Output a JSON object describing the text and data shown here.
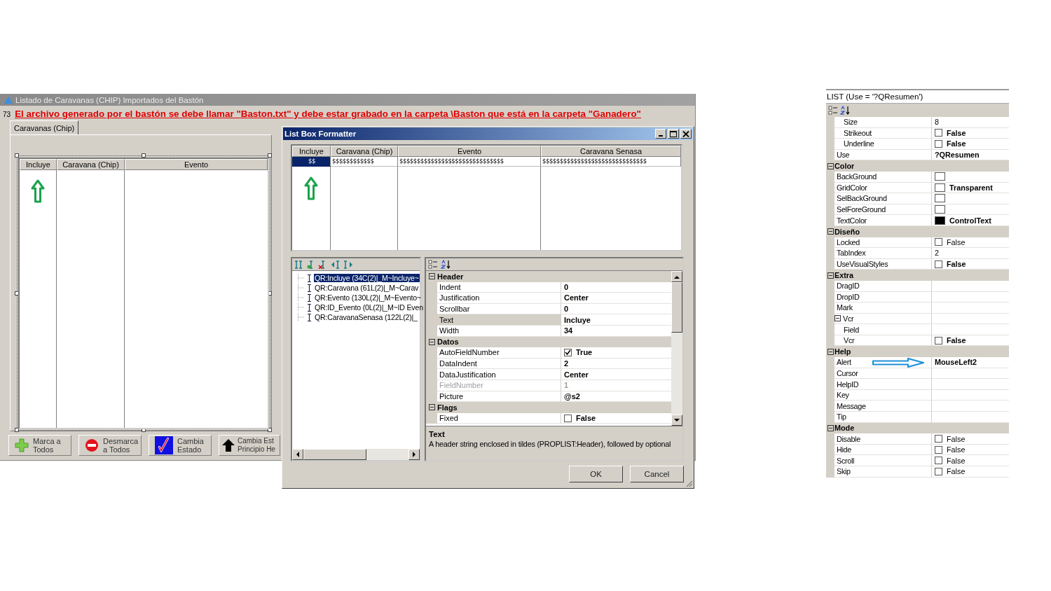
{
  "main_window": {
    "title": "Listado de Caravanas (CHIP) Importados del Bastón",
    "line_number": "73",
    "warning": "El archivo generado por el bastón se debe llamar \"Baston.txt\" y debe estar grabado en la carpeta \\Baston que está en la carpeta \"Ganadero\"",
    "tabs": [
      {
        "label": "Caravanas (Chip)",
        "selected": true
      }
    ],
    "list": {
      "columns": [
        "Incluye",
        "Caravana (Chip)",
        "Evento"
      ]
    },
    "buttons": [
      {
        "label": "Marca a\nTodos",
        "kind": "plus"
      },
      {
        "label": "Desmarca\na Todos",
        "kind": "no-entry"
      },
      {
        "label": "Cambia\nEstado",
        "kind": "check"
      },
      {
        "label": "Cambia Est\nPrincipio He",
        "kind": "up-arrow"
      }
    ]
  },
  "formatter": {
    "title": "List Box Formatter",
    "preview": {
      "columns": [
        "Incluye",
        "Caravana (Chip)",
        "Evento",
        "Caravana Senasa"
      ],
      "cells": [
        {
          "text": "$$",
          "selected": true
        },
        {
          "text": "$$$$$$$$$$$$",
          "selected": false
        },
        {
          "text": "$$$$$$$$$$$$$$$$$$$$$$$$$$$$$$",
          "selected": false
        },
        {
          "text": "$$$$$$$$$$$$$$$$$$$$$$$$$$$$$$",
          "selected": false
        }
      ]
    },
    "tree": [
      {
        "label": "QR:Incluye (34C(2)|_M~Incluye~",
        "selected": true
      },
      {
        "label": "QR:Caravana (61L(2)|_M~Carav",
        "selected": false
      },
      {
        "label": "QR:Evento (130L(2)|_M~Evento~",
        "selected": false
      },
      {
        "label": "QR:ID_Evento (0L(2)|_M~ID Even",
        "selected": false
      },
      {
        "label": "QR:CaravanaSenasa (122L(2)|_",
        "selected": false
      }
    ],
    "properties": {
      "sections": [
        {
          "name": "Header",
          "expanded": true,
          "rows": [
            {
              "name": "Indent",
              "kind": "text",
              "value": "0",
              "selected": false,
              "disabled": false
            },
            {
              "name": "Justification",
              "kind": "text",
              "value": "Center",
              "selected": false,
              "disabled": false
            },
            {
              "name": "Scrollbar",
              "kind": "text",
              "value": "0",
              "selected": false,
              "disabled": false
            },
            {
              "name": "Text",
              "kind": "text",
              "value": "Incluye",
              "selected": true,
              "disabled": false
            },
            {
              "name": "Width",
              "kind": "text",
              "value": "34",
              "selected": false,
              "disabled": false
            }
          ]
        },
        {
          "name": "Datos",
          "expanded": true,
          "rows": [
            {
              "name": "AutoFieldNumber",
              "kind": "checkbox",
              "checked": true,
              "value": "True",
              "selected": false,
              "disabled": false
            },
            {
              "name": "DataIndent",
              "kind": "text",
              "value": "2",
              "selected": false,
              "disabled": false
            },
            {
              "name": "DataJustification",
              "kind": "text",
              "value": "Center",
              "selected": false,
              "disabled": false
            },
            {
              "name": "FieldNumber",
              "kind": "text",
              "value": "1",
              "selected": false,
              "disabled": true
            },
            {
              "name": "Picture",
              "kind": "text",
              "value": "@s2",
              "selected": false,
              "disabled": false
            }
          ]
        },
        {
          "name": "Flags",
          "expanded": true,
          "rows": [
            {
              "name": "Fixed",
              "kind": "checkbox",
              "checked": false,
              "value": "False",
              "selected": false,
              "disabled": false
            }
          ]
        }
      ]
    },
    "description": {
      "title": "Text",
      "text": "A header string enclosed in tildes (PROPLIST:Header), followed by optional"
    },
    "buttons": [
      "OK",
      "Cancel"
    ]
  },
  "property_panel": {
    "title": "LIST (Use = '?QResumen')",
    "sections": [
      {
        "rows": [
          {
            "kind": "group",
            "children": [
              {
                "name": "Size",
                "kind": "text",
                "value": "8",
                "bold": false
              },
              {
                "name": "Strikeout",
                "kind": "checkbox",
                "checked": false,
                "value": "False",
                "bold": true
              },
              {
                "name": "Underline",
                "kind": "checkbox",
                "checked": false,
                "value": "False",
                "bold": true
              }
            ]
          },
          {
            "name": "Use",
            "kind": "text",
            "value": "?QResumen",
            "bold": true
          }
        ]
      },
      {
        "name": "Color",
        "expanded": true,
        "rows": [
          {
            "name": "BackGround",
            "kind": "swatch",
            "color": "#ffffff"
          },
          {
            "name": "GridColor",
            "kind": "swatch",
            "color": "#ffffff",
            "value": "Transparent",
            "bold": true
          },
          {
            "name": "SelBackGround",
            "kind": "swatch",
            "color": "#ffffff"
          },
          {
            "name": "SelForeGround",
            "kind": "swatch",
            "color": "#ffffff"
          },
          {
            "name": "TextColor",
            "kind": "swatch",
            "color": "#000000",
            "value": "ControlText",
            "bold": true
          }
        ]
      },
      {
        "name": "Diseño",
        "expanded": true,
        "rows": [
          {
            "name": "Locked",
            "kind": "checkbox",
            "checked": false,
            "value": "False",
            "bold": false
          },
          {
            "name": "TabIndex",
            "kind": "text",
            "value": "2",
            "bold": false
          },
          {
            "name": "UseVisualStyles",
            "kind": "checkbox",
            "checked": false,
            "value": "False",
            "bold": true
          }
        ]
      },
      {
        "name": "Extra",
        "expanded": true,
        "rows": [
          {
            "name": "DragID",
            "kind": "text"
          },
          {
            "name": "DropID",
            "kind": "text"
          },
          {
            "name": "Mark",
            "kind": "text"
          },
          {
            "name": "Vcr",
            "kind": "group",
            "expanded": true,
            "children": [
              {
                "name": "Field",
                "kind": "text"
              },
              {
                "name": "Vcr",
                "kind": "checkbox",
                "checked": false,
                "value": "False",
                "bold": true
              }
            ]
          }
        ]
      },
      {
        "name": "Help",
        "expanded": true,
        "rows": [
          {
            "name": "Alert",
            "kind": "text",
            "value": "MouseLeft2",
            "bold": true,
            "annotated": true
          },
          {
            "name": "Cursor",
            "kind": "text"
          },
          {
            "name": "HelpID",
            "kind": "text"
          },
          {
            "name": "Key",
            "kind": "text"
          },
          {
            "name": "Message",
            "kind": "text"
          },
          {
            "name": "Tip",
            "kind": "text"
          }
        ]
      },
      {
        "name": "Mode",
        "expanded": true,
        "rows": [
          {
            "name": "Disable",
            "kind": "checkbox",
            "checked": false,
            "value": "False",
            "bold": false
          },
          {
            "name": "Hide",
            "kind": "checkbox",
            "checked": false,
            "value": "False",
            "bold": false
          },
          {
            "name": "Scroll",
            "kind": "checkbox",
            "checked": false,
            "value": "False",
            "bold": false
          },
          {
            "name": "Skip",
            "kind": "checkbox",
            "checked": false,
            "value": "False",
            "bold": false
          }
        ]
      }
    ]
  }
}
